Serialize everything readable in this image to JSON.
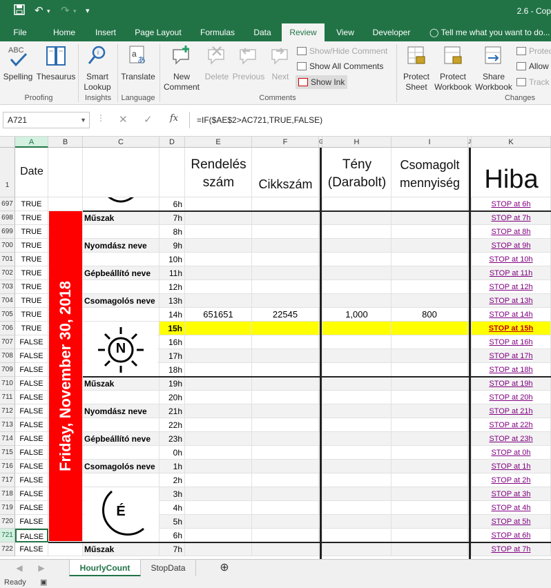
{
  "title_bar": {
    "document_title": "2.6 - Cop"
  },
  "tabs": [
    "File",
    "Home",
    "Insert",
    "Page Layout",
    "Formulas",
    "Data",
    "Review",
    "View",
    "Developer"
  ],
  "active_tab": "Review",
  "tell_me": "Tell me what you want to do...",
  "ribbon": {
    "proofing": {
      "spelling": "Spelling",
      "thesaurus": "Thesaurus",
      "group": "Proofing"
    },
    "insights": {
      "smart_lookup": "Smart Lookup",
      "group": "Insights"
    },
    "language": {
      "translate": "Translate",
      "group": "Language"
    },
    "comments": {
      "new_comment": "New Comment",
      "delete": "Delete",
      "previous": "Previous",
      "next": "Next",
      "show_hide": "Show/Hide Comment",
      "show_all": "Show All Comments",
      "show_ink": "Show Ink",
      "group": "Comments"
    },
    "changes": {
      "protect_sheet": "Protect Sheet",
      "protect_workbook": "Protect Workbook",
      "share_workbook": "Share Workbook",
      "protect_share": "Protec",
      "allow": "Allow",
      "track": "Track",
      "group": "Changes"
    }
  },
  "formula_bar": {
    "name_box": "A721",
    "fx": "fx",
    "formula": "=IF($AE$2>AC721,TRUE,FALSE)"
  },
  "columns": [
    "A",
    "B",
    "C",
    "D",
    "E",
    "F",
    "G",
    "H",
    "I",
    "J",
    "K"
  ],
  "header_row": {
    "row_number": "1",
    "date": "Date",
    "rendeles": "Rendelés szám",
    "cikkszam": "Cikkszám",
    "teny": "Tény (Darabolt)",
    "csomagolt": "Csomagolt mennyiség",
    "hiba": "Hiba"
  },
  "date_label": "Friday, November 30, 2018",
  "sun_letter": "N",
  "moon_letter": "É",
  "rows": [
    {
      "num": "697",
      "a": "TRUE",
      "c": "",
      "d": "6h",
      "e": "",
      "f": "",
      "h": "",
      "i": "",
      "k": "STOP at 6h"
    },
    {
      "num": "698",
      "a": "TRUE",
      "c": "Műszak",
      "d": "7h",
      "e": "",
      "f": "",
      "h": "",
      "i": "",
      "k": "STOP at 7h"
    },
    {
      "num": "699",
      "a": "TRUE",
      "c": "",
      "d": "8h",
      "e": "",
      "f": "",
      "h": "",
      "i": "",
      "k": "STOP at 8h"
    },
    {
      "num": "700",
      "a": "TRUE",
      "c": "Nyomdász neve",
      "d": "9h",
      "e": "",
      "f": "",
      "h": "",
      "i": "",
      "k": "STOP at 9h"
    },
    {
      "num": "701",
      "a": "TRUE",
      "c": "",
      "d": "10h",
      "e": "",
      "f": "",
      "h": "",
      "i": "",
      "k": "STOP at 10h"
    },
    {
      "num": "702",
      "a": "TRUE",
      "c": "Gépbeállító neve",
      "d": "11h",
      "e": "",
      "f": "",
      "h": "",
      "i": "",
      "k": "STOP at 11h"
    },
    {
      "num": "703",
      "a": "TRUE",
      "c": "",
      "d": "12h",
      "e": "",
      "f": "",
      "h": "",
      "i": "",
      "k": "STOP at 12h"
    },
    {
      "num": "704",
      "a": "TRUE",
      "c": "Csomagolós neve",
      "d": "13h",
      "e": "",
      "f": "",
      "h": "",
      "i": "",
      "k": "STOP at 13h"
    },
    {
      "num": "705",
      "a": "TRUE",
      "c": "",
      "d": "14h",
      "e": "651651",
      "f": "22545",
      "h": "1,000",
      "i": "800",
      "k": "STOP at 14h"
    },
    {
      "num": "706",
      "a": "TRUE",
      "c": "",
      "d": "15h",
      "e": "",
      "f": "",
      "h": "",
      "i": "",
      "k": "STOP at 15h"
    },
    {
      "num": "707",
      "a": "FALSE",
      "c": "",
      "d": "16h",
      "e": "",
      "f": "",
      "h": "",
      "i": "",
      "k": "STOP at 16h"
    },
    {
      "num": "708",
      "a": "FALSE",
      "c": "",
      "d": "17h",
      "e": "",
      "f": "",
      "h": "",
      "i": "",
      "k": "STOP at 17h"
    },
    {
      "num": "709",
      "a": "FALSE",
      "c": "",
      "d": "18h",
      "e": "",
      "f": "",
      "h": "",
      "i": "",
      "k": "STOP at 18h"
    },
    {
      "num": "710",
      "a": "FALSE",
      "c": "Műszak",
      "d": "19h",
      "e": "",
      "f": "",
      "h": "",
      "i": "",
      "k": "STOP at 19h"
    },
    {
      "num": "711",
      "a": "FALSE",
      "c": "",
      "d": "20h",
      "e": "",
      "f": "",
      "h": "",
      "i": "",
      "k": "STOP at 20h"
    },
    {
      "num": "712",
      "a": "FALSE",
      "c": "Nyomdász neve",
      "d": "21h",
      "e": "",
      "f": "",
      "h": "",
      "i": "",
      "k": "STOP at 21h"
    },
    {
      "num": "713",
      "a": "FALSE",
      "c": "",
      "d": "22h",
      "e": "",
      "f": "",
      "h": "",
      "i": "",
      "k": "STOP at 22h"
    },
    {
      "num": "714",
      "a": "FALSE",
      "c": "Gépbeállító neve",
      "d": "23h",
      "e": "",
      "f": "",
      "h": "",
      "i": "",
      "k": "STOP at 23h"
    },
    {
      "num": "715",
      "a": "FALSE",
      "c": "",
      "d": "0h",
      "e": "",
      "f": "",
      "h": "",
      "i": "",
      "k": "STOP at 0h"
    },
    {
      "num": "716",
      "a": "FALSE",
      "c": "Csomagolós neve",
      "d": "1h",
      "e": "",
      "f": "",
      "h": "",
      "i": "",
      "k": "STOP at 1h"
    },
    {
      "num": "717",
      "a": "FALSE",
      "c": "",
      "d": "2h",
      "e": "",
      "f": "",
      "h": "",
      "i": "",
      "k": "STOP at 2h"
    },
    {
      "num": "718",
      "a": "FALSE",
      "c": "",
      "d": "3h",
      "e": "",
      "f": "",
      "h": "",
      "i": "",
      "k": "STOP at 3h"
    },
    {
      "num": "719",
      "a": "FALSE",
      "c": "",
      "d": "4h",
      "e": "",
      "f": "",
      "h": "",
      "i": "",
      "k": "STOP at 4h"
    },
    {
      "num": "720",
      "a": "FALSE",
      "c": "",
      "d": "5h",
      "e": "",
      "f": "",
      "h": "",
      "i": "",
      "k": "STOP at 5h"
    },
    {
      "num": "721",
      "a": "FALSE",
      "c": "",
      "d": "6h",
      "e": "",
      "f": "",
      "h": "",
      "i": "",
      "k": "STOP at 6h"
    },
    {
      "num": "722",
      "a": "FALSE",
      "c": "Műszak",
      "d": "7h",
      "e": "",
      "f": "",
      "h": "",
      "i": "",
      "k": "STOP at 7h"
    }
  ],
  "highlight_row": "706",
  "selected_row": "721",
  "sheet_tabs": [
    "HourlyCount",
    "StopData"
  ],
  "active_sheet": "HourlyCount",
  "status": "Ready",
  "colors": {
    "excel_green": "#217346",
    "date_strip": "#ff0000",
    "highlight": "#ffff00",
    "link": "#800080"
  }
}
